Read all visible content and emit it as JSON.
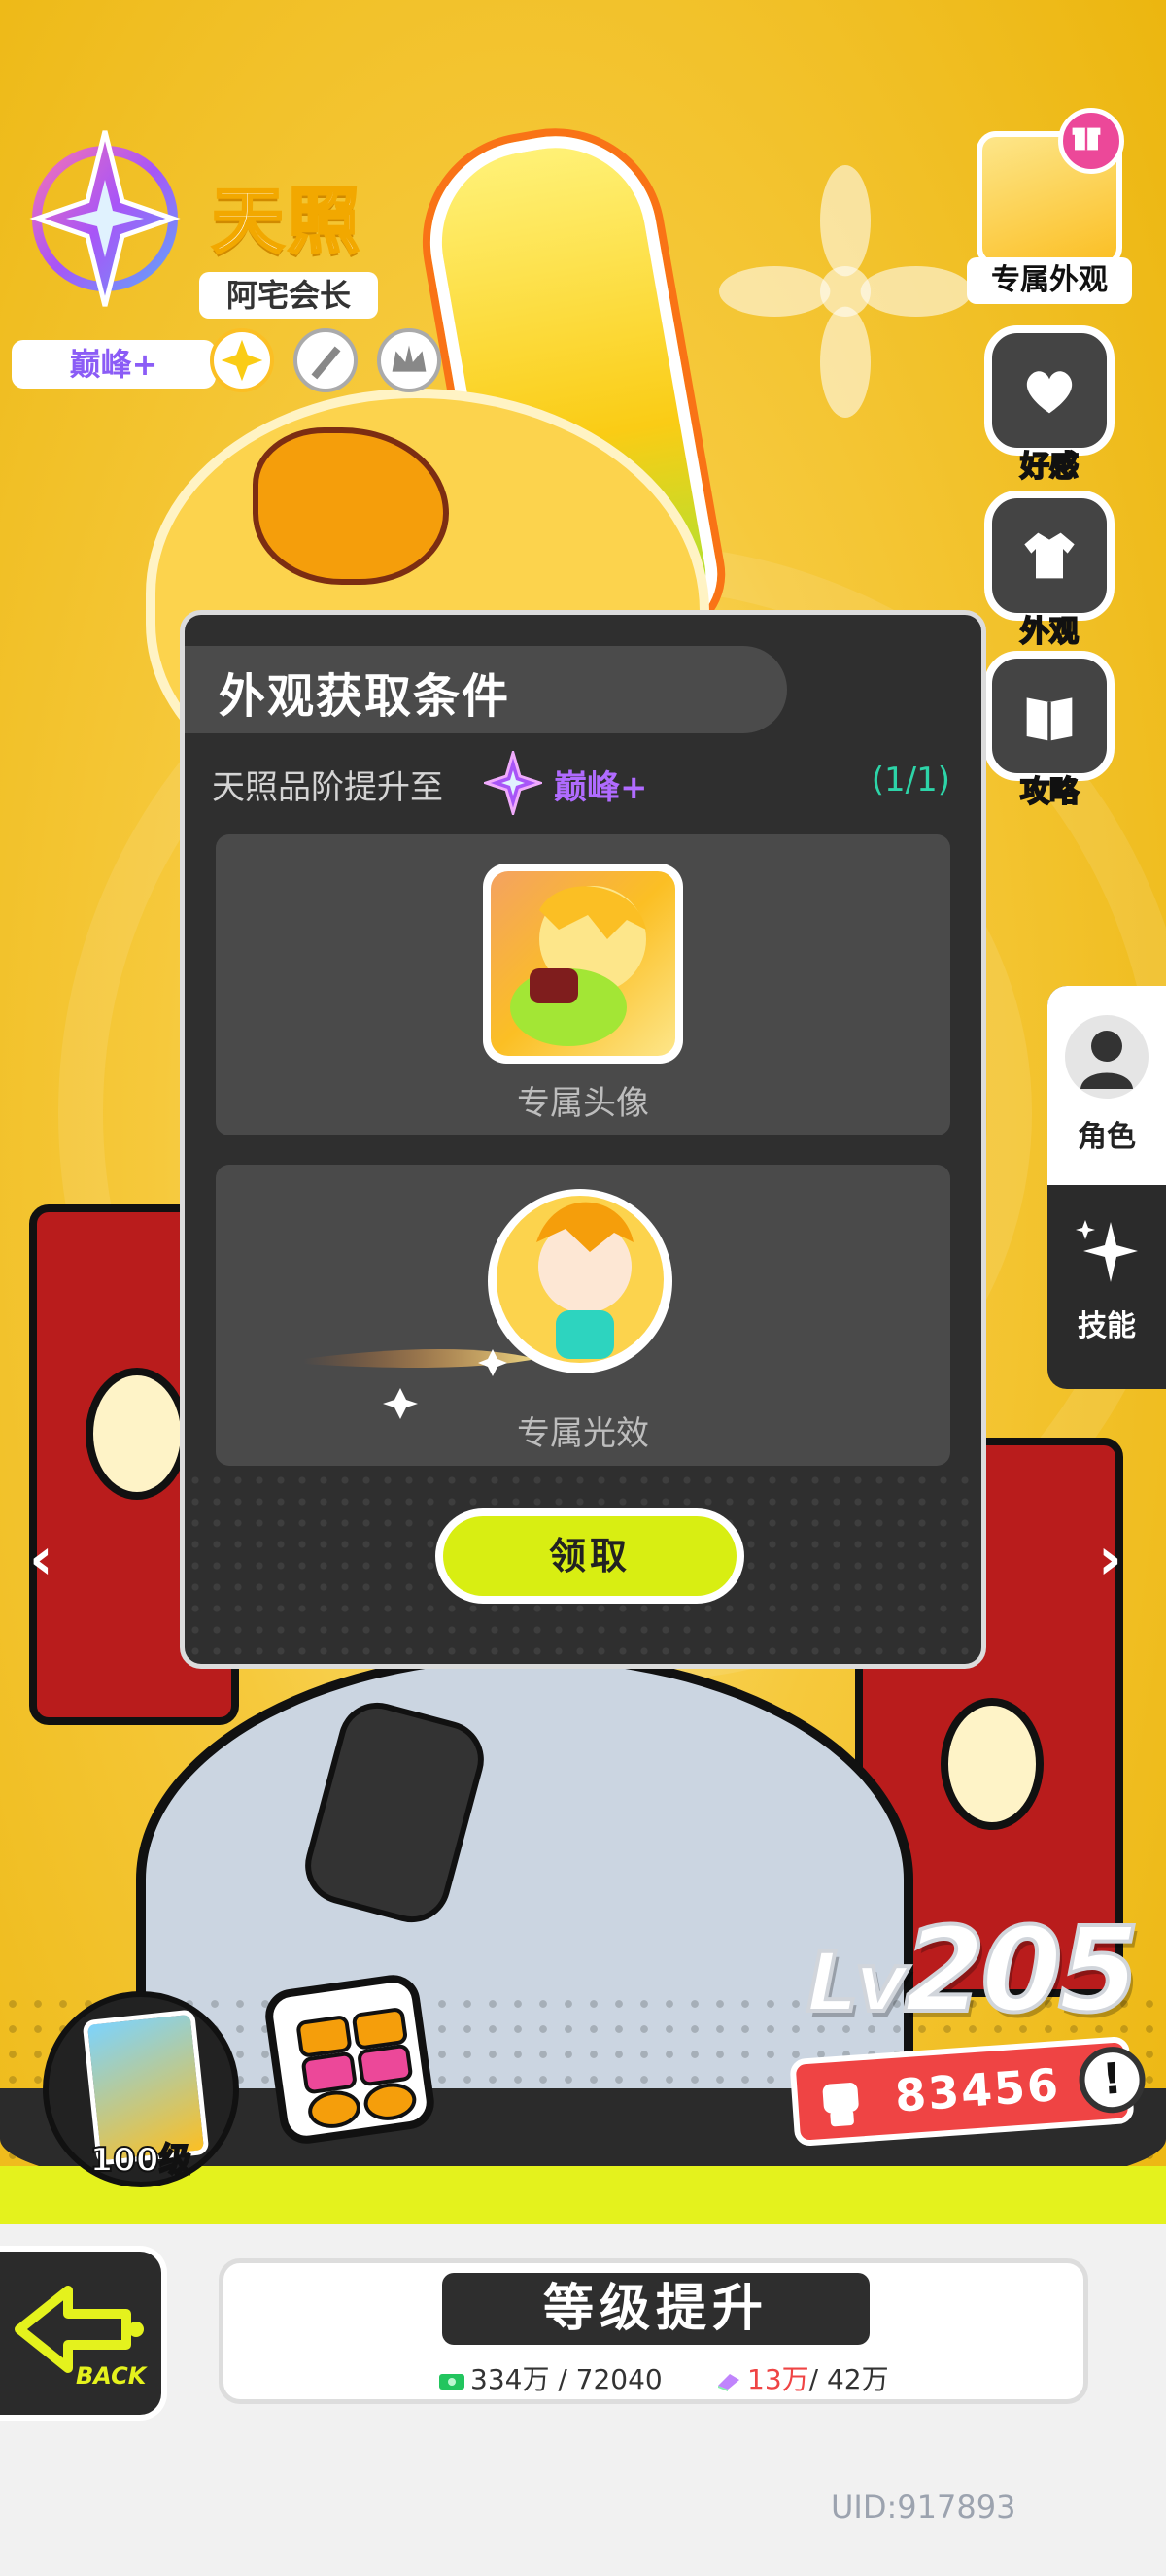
{
  "character": {
    "name": "天照",
    "title": "阿宅会长",
    "rank": "巅峰+"
  },
  "side_menu": {
    "exclusive_look": "专属外观",
    "affinity": "好感",
    "appearance": "外观",
    "guide": "攻略"
  },
  "tabs": {
    "role": "角色",
    "skill": "技能"
  },
  "modal": {
    "title": "外观获取条件",
    "condition_text": "天照品阶提升至",
    "condition_rank": "巅峰+",
    "condition_progress": "(1/1)",
    "rewards": [
      {
        "label": "专属头像"
      },
      {
        "label": "专属光效"
      }
    ],
    "claim_button": "领取"
  },
  "stats": {
    "level_prefix": "Lv",
    "level": "205",
    "power": "83456",
    "power_alert": "!"
  },
  "bottom": {
    "level_reward": "100级",
    "back": "BACK",
    "upgrade_title": "等级提升",
    "cost_gold": "334万 / 72040",
    "cost_material_have": "13万",
    "cost_material_need": "/ 42万",
    "uid": "UID:917893"
  },
  "colors": {
    "accent_lime": "#d8ee12",
    "rank_purple": "#b06bff",
    "progress_green": "#2dd4a8",
    "power_red": "#ef4444"
  }
}
